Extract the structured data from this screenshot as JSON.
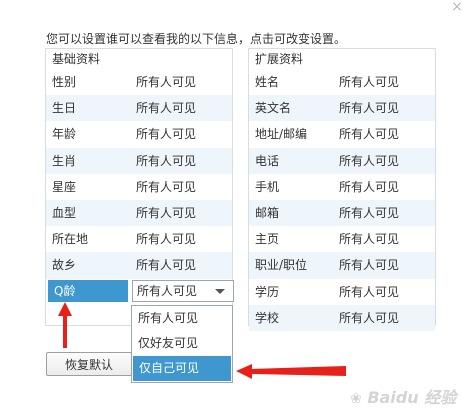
{
  "instruction": "您可以设置谁可以查看我的以下信息，点击可改变设置。",
  "close_glyph": "×",
  "basic": {
    "title": "基础资料",
    "rows": [
      {
        "label": "性别",
        "value": "所有人可见"
      },
      {
        "label": "生日",
        "value": "所有人可见"
      },
      {
        "label": "年龄",
        "value": "所有人可见"
      },
      {
        "label": "生肖",
        "value": "所有人可见"
      },
      {
        "label": "星座",
        "value": "所有人可见"
      },
      {
        "label": "血型",
        "value": "所有人可见"
      },
      {
        "label": "所在地",
        "value": "所有人可见"
      },
      {
        "label": "故乡",
        "value": "所有人可见"
      },
      {
        "label": "Q龄",
        "value": "所有人可见"
      }
    ]
  },
  "extended": {
    "title": "扩展资料",
    "rows": [
      {
        "label": "姓名",
        "value": "所有人可见"
      },
      {
        "label": "英文名",
        "value": "所有人可见"
      },
      {
        "label": "地址/邮编",
        "value": "所有人可见"
      },
      {
        "label": "电话",
        "value": "所有人可见"
      },
      {
        "label": "手机",
        "value": "所有人可见"
      },
      {
        "label": "邮箱",
        "value": "所有人可见"
      },
      {
        "label": "主页",
        "value": "所有人可见"
      },
      {
        "label": "职业/职位",
        "value": "所有人可见"
      },
      {
        "label": "学历",
        "value": "所有人可见"
      },
      {
        "label": "学校",
        "value": "所有人可见"
      }
    ]
  },
  "dropdown": {
    "options": [
      "所有人可见",
      "仅好友可见",
      "仅自己可见"
    ],
    "highlighted": "仅自己可见"
  },
  "reset_label": "恢复默认",
  "watermark": "Baidu 经验",
  "colors": {
    "accent": "#3f97d0",
    "row_alt": "#eef5fb",
    "arrow": "#e8201a",
    "border": "#d6dde4"
  }
}
